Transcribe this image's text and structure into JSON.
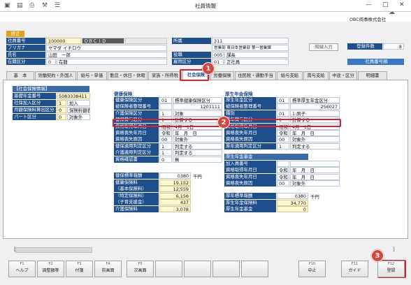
{
  "window": {
    "title": "社員情報",
    "company": "OBC商事株式会社"
  },
  "toolbar": {
    "status": "修正"
  },
  "header": {
    "shain_no_label": "社員番号",
    "shain_no": "100000",
    "obcid_label": "ＯＢＣｉＤ",
    "furigana_label": "フリガナ",
    "furigana": "ヤマダ イチロウ",
    "name_label": "氏名",
    "name": "山田　一郎",
    "status_label": "在籍区分",
    "status_code": "0",
    "status_value": "在籍",
    "dept_label": "所属",
    "dept_code": "311",
    "dept_value": "営業部 東日本営業部 第一営業課",
    "post_label": "役職",
    "post_code": "005",
    "post_value": "課長",
    "emp_label": "雇用区分",
    "emp_code": "01",
    "emp_value": "正社員",
    "notify_btn": "知緑入力",
    "count_label": "登録件数",
    "count_value": "8",
    "shain_no_btn": "社員番号順"
  },
  "tabs": [
    "基　本",
    "労働契約・外国人",
    "給与・単価",
    "勤怠・休日・休暇",
    "家族・所得税",
    "社会保険",
    "労働保険",
    "住民税・通勤手当",
    "給与支給",
    "賞与支給",
    "中途・区分",
    "明細書"
  ],
  "left": {
    "title": "【社会保険情報】",
    "rows": [
      {
        "label": "基礎年金番号",
        "code": "5083338411",
        "value": ""
      },
      {
        "label": "社保加入区分",
        "code": "1",
        "value": "加入"
      },
      {
        "label": "月額保険料算出区分",
        "code": "0",
        "value": "保険料額表"
      },
      {
        "label": "パート区分",
        "code": "0",
        "value": "対象外"
      }
    ]
  },
  "kenko": {
    "title": "健康保険",
    "rows": [
      {
        "label": "健康保険区分",
        "code": "01",
        "value": "標準健康保険区分"
      },
      {
        "label": "被保険者整理番号",
        "code": "",
        "value": "1201111"
      },
      {
        "label": "介護保険区分",
        "code": "1",
        "value": "対象"
      },
      {
        "label": "健保賞与区分",
        "code": "1",
        "value": "計算する"
      },
      {
        "label": "資格取得年月日",
        "code": "昭和54年",
        "value": "4月　1日"
      },
      {
        "label": "資格喪失年月日",
        "code": "令和",
        "value": "年　月　日"
      },
      {
        "label": "資格喪失原因",
        "code": "00",
        "value": "対象外"
      },
      {
        "label": "健保適用判定区分",
        "code": "1",
        "value": "判定する"
      },
      {
        "label": "介護適用判定区分",
        "code": "1",
        "value": "判定する"
      },
      {
        "label": "資格確認書",
        "code": "0",
        "value": "無"
      }
    ],
    "money_rows": [
      {
        "label": "健保標準報酬",
        "value": "0380",
        "unit": "千円"
      },
      {
        "label": "健康保険料",
        "value": "19,152"
      },
      {
        "label": "（基本保険料）",
        "value": "12,559"
      },
      {
        "label": "（特定保険料）",
        "value": "6,156"
      },
      {
        "label": "（子育支援金）",
        "value": "437"
      },
      {
        "label": "介護保険料",
        "value": "3,078"
      }
    ]
  },
  "kosei": {
    "title": "厚生年金保険",
    "rows": [
      {
        "label": "厚生年金区分",
        "code": "01",
        "value": "標準厚生年金区分"
      },
      {
        "label": "被保険者整理番号",
        "code": "",
        "value": "256027"
      },
      {
        "label": "種別",
        "code": "01",
        "value": "1:男子"
      },
      {
        "label": "厚年賞与区分",
        "code": "1",
        "value": "計算する"
      },
      {
        "label": "資格取得年月日",
        "code": "昭和54年",
        "value": "4月　1日"
      },
      {
        "label": "資格喪失年月日",
        "code": "令和",
        "value": "年　月　日"
      },
      {
        "label": "資格喪失原因",
        "code": "00",
        "value": "対象外"
      },
      {
        "label": "厚年適用判定区分",
        "code": "1",
        "value": "判定する"
      }
    ],
    "kikin_title": "厚生年金基金",
    "kikin_rows": [
      {
        "label": "加入員番号",
        "code": "",
        "value": ""
      },
      {
        "label": "資格取得年月日",
        "code": "令和",
        "value": "年　月　日"
      },
      {
        "label": "資格喪失年月日",
        "code": "令和",
        "value": "年　月　日"
      },
      {
        "label": "資格喪失原因",
        "code": "00",
        "value": "対象外"
      }
    ],
    "money_rows": [
      {
        "label": "厚年標準報酬",
        "value": "0380",
        "unit": "千円"
      },
      {
        "label": "厚生年金保険料",
        "value": "34,770"
      },
      {
        "label": "厚生年金基金",
        "value": "0"
      }
    ]
  },
  "fkeys": [
    {
      "key": "F1",
      "label": "ヘルプ"
    },
    {
      "key": "F2",
      "label": "調整額等"
    },
    {
      "key": "F3",
      "label": "付箋"
    },
    {
      "key": "F4",
      "label": "前画面"
    },
    {
      "key": "F5",
      "label": "次画面"
    },
    {
      "key": "",
      "label": ""
    },
    {
      "key": "",
      "label": ""
    },
    {
      "key": "",
      "label": ""
    },
    {
      "key": "",
      "label": ""
    },
    {
      "key": "F10",
      "label": "中止"
    },
    {
      "key": "F11",
      "label": "ガイド"
    },
    {
      "key": "F12",
      "label": "登録"
    }
  ],
  "badges": [
    "1",
    "2",
    "3"
  ],
  "colors": {
    "header_blue": "#1f4e8c",
    "highlight_red": "#d6232a"
  }
}
